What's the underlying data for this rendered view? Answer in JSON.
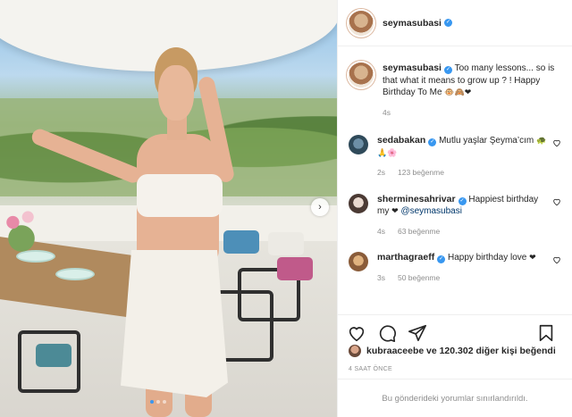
{
  "post": {
    "author": "seymasubasi",
    "author_verified": true
  },
  "caption": {
    "username": "seymasubasi",
    "text": "Too many lessons... so is that what it means to grow up ? ! Happy Birthday To Me",
    "emojis": "🐵🙈❤",
    "time": "4s"
  },
  "comments": [
    {
      "username": "sedabakan",
      "verified": true,
      "text": "Mutlu yaşlar Şeyma’cım",
      "emojis": "🐢🙏🌸",
      "time": "2s",
      "likes": "123 beğenme"
    },
    {
      "username": "sherminesahrivar",
      "verified": true,
      "text": "Happiest birthday my",
      "emojis": "❤",
      "mention": "@seymasubasi",
      "time": "4s",
      "likes": "63 beğenme"
    },
    {
      "username": "marthagraeff",
      "verified": true,
      "text": "Happy birthday love",
      "emojis": "❤",
      "time": "3s",
      "likes": "50 beğenme"
    }
  ],
  "likes_line": {
    "user": "kubraaceebe",
    "rest": "ve 120.302 diğer kişi beğendi"
  },
  "post_time": "4 SAAT ÖNCE",
  "comments_limited": "Bu gönderideki yorumlar sınırlandırıldı.",
  "icons": [
    "heart-icon",
    "comment-icon",
    "share-icon",
    "save-icon",
    "verified-icon",
    "next-arrow-icon"
  ],
  "colors": {
    "verified": "#3897f0",
    "link": "#00376b",
    "muted": "#8e8e8e",
    "heart": "#ed4956"
  }
}
